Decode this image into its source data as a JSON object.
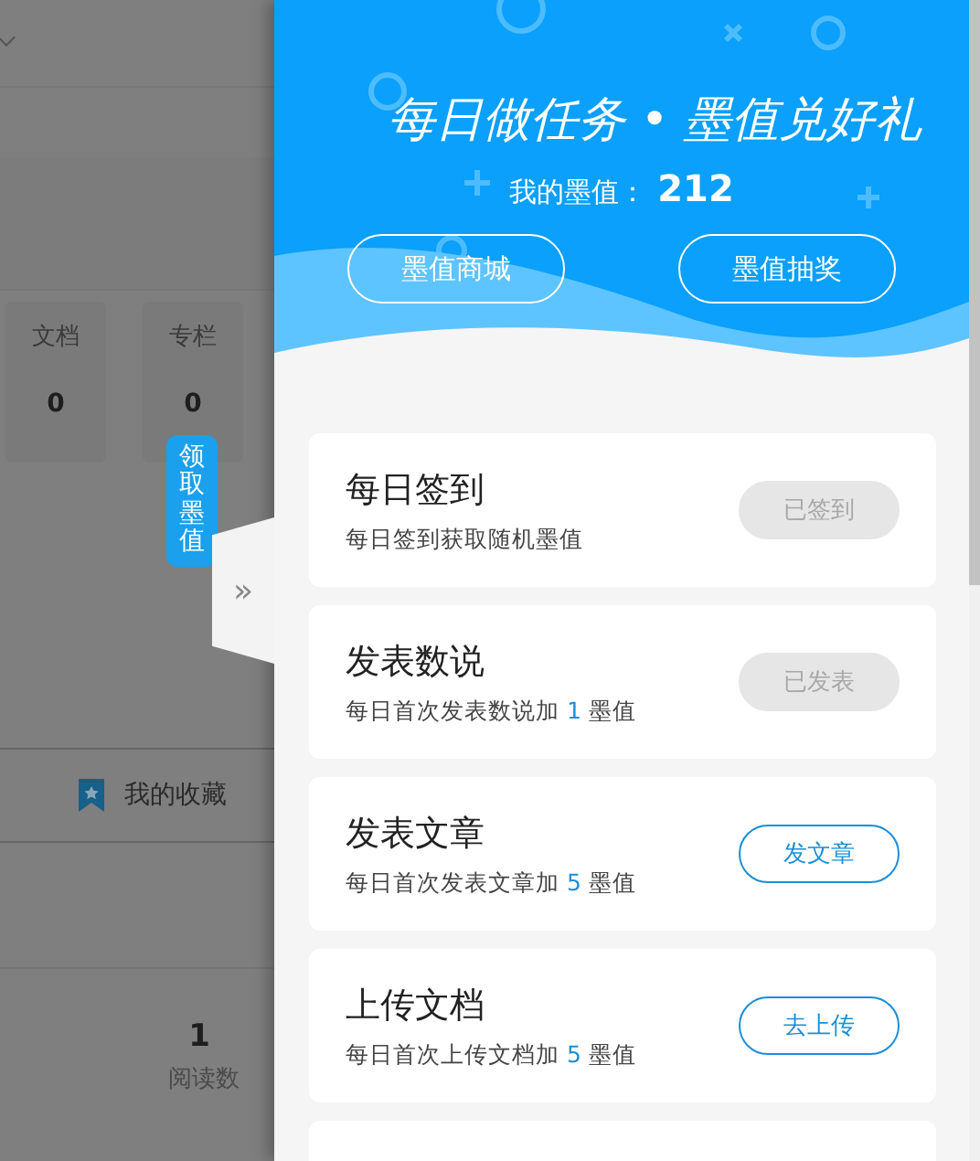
{
  "background_page": {
    "stats": [
      {
        "label": "文档",
        "value": "0"
      },
      {
        "label": "专栏",
        "value": "0"
      }
    ],
    "favorites_tab": "我的收藏",
    "reads": {
      "value": "1",
      "label": "阅读数"
    }
  },
  "side_tab": "领取墨值",
  "collapse_button": "»",
  "header": {
    "title": "每日做任务 • 墨值兑好礼",
    "points_label": "我的墨值：",
    "points": "212",
    "buttons": [
      "墨值商城",
      "墨值抽奖"
    ]
  },
  "tasks": [
    {
      "title": "每日签到",
      "desc": [
        {
          "text": "每日签到获取随机墨值",
          "highlight": false
        }
      ],
      "action": "已签到",
      "done": true
    },
    {
      "title": "发表数说",
      "desc": [
        {
          "text": "每日首次发表数说加",
          "highlight": false
        },
        {
          "text": " 1 ",
          "highlight": true
        },
        {
          "text": "墨值",
          "highlight": false
        }
      ],
      "action": "已发表",
      "done": true
    },
    {
      "title": "发表文章",
      "desc": [
        {
          "text": "每日首次发表文章加",
          "highlight": false
        },
        {
          "text": " 5 ",
          "highlight": true
        },
        {
          "text": "墨值",
          "highlight": false
        }
      ],
      "action": "发文章",
      "done": false
    },
    {
      "title": "上传文档",
      "desc": [
        {
          "text": "每日首次上传文档加",
          "highlight": false
        },
        {
          "text": " 5 ",
          "highlight": true
        },
        {
          "text": "墨值",
          "highlight": false
        }
      ],
      "action": "去上传",
      "done": false
    }
  ]
}
